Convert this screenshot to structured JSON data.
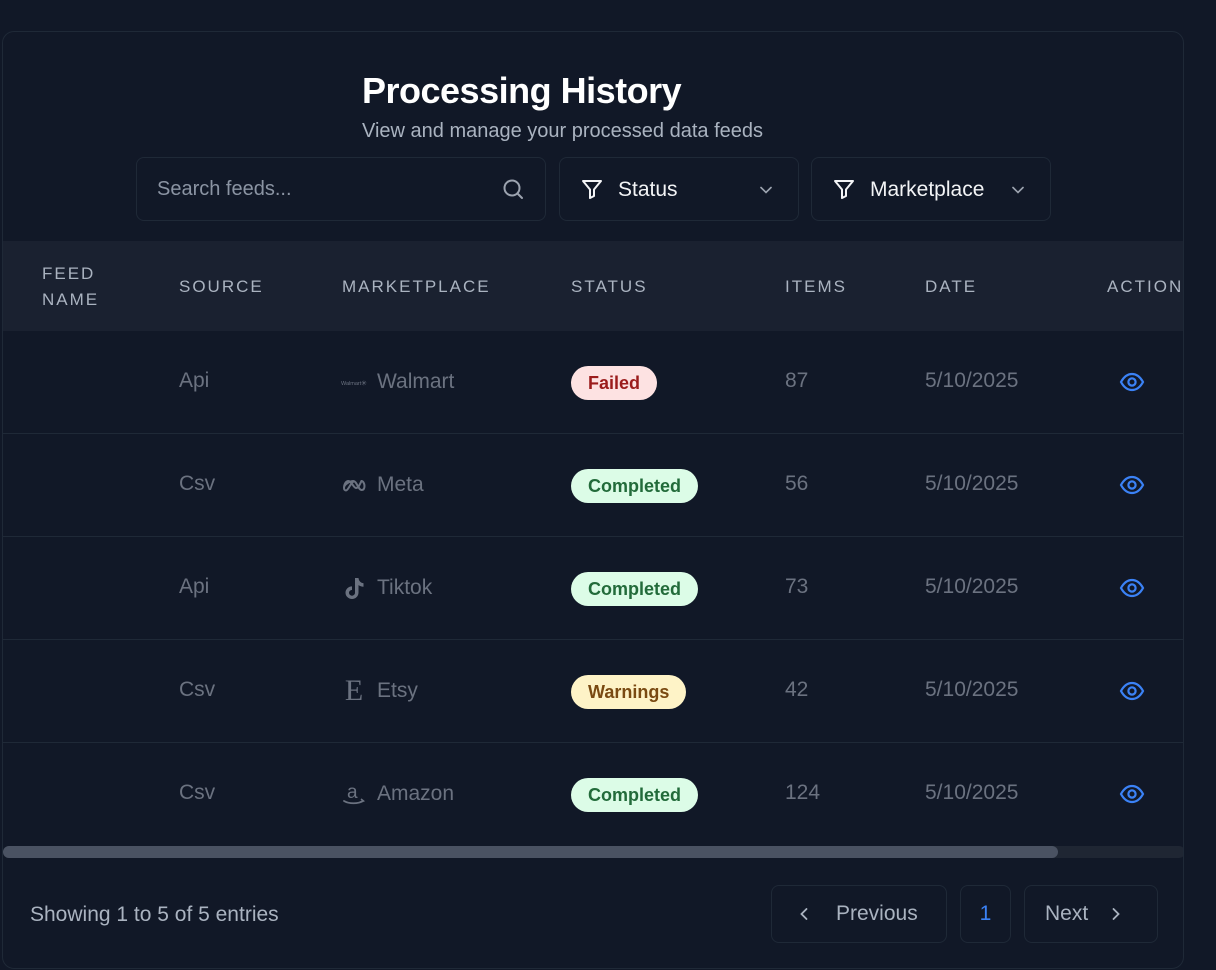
{
  "header": {
    "title": "Processing History",
    "subtitle": "View and manage your processed data feeds"
  },
  "filters": {
    "search_placeholder": "Search feeds...",
    "status_label": "Status",
    "marketplace_label": "Marketplace"
  },
  "table": {
    "columns": {
      "feed_name_1": "Feed",
      "feed_name_2": "Name",
      "source": "Source",
      "marketplace": "Marketplace",
      "status": "Status",
      "items": "Items",
      "date": "Date",
      "actions": "Action"
    },
    "rows": [
      {
        "feed_name": "",
        "source": "Api",
        "marketplace": "Walmart",
        "marketplace_icon": "walmart-logo-icon",
        "status": "Failed",
        "status_color": "#fde2e2",
        "items": "87",
        "date": "5/10/2025"
      },
      {
        "feed_name": "",
        "source": "Csv",
        "marketplace": "Meta",
        "marketplace_icon": "meta-logo-icon",
        "status": "Completed",
        "status_color": "#dcfce7",
        "items": "56",
        "date": "5/10/2025"
      },
      {
        "feed_name": "",
        "source": "Api",
        "marketplace": "Tiktok",
        "marketplace_icon": "tiktok-logo-icon",
        "status": "Completed",
        "status_color": "#dcfce7",
        "items": "73",
        "date": "5/10/2025"
      },
      {
        "feed_name": "",
        "source": "Csv",
        "marketplace": "Etsy",
        "marketplace_icon": "etsy-logo-icon",
        "status": "Warnings",
        "status_color": "#fef3c7",
        "items": "42",
        "date": "5/10/2025"
      },
      {
        "feed_name": "",
        "source": "Csv",
        "marketplace": "Amazon",
        "marketplace_icon": "amazon-logo-icon",
        "status": "Completed",
        "status_color": "#dcfce7",
        "items": "124",
        "date": "5/10/2025"
      }
    ]
  },
  "pagination": {
    "showing_text": "Showing 1 to 5 of 5 entries",
    "previous_label": "Previous",
    "current_page": "1",
    "next_label": "Next"
  },
  "colors": {
    "background": "#111827",
    "accent": "#3b82f6"
  }
}
